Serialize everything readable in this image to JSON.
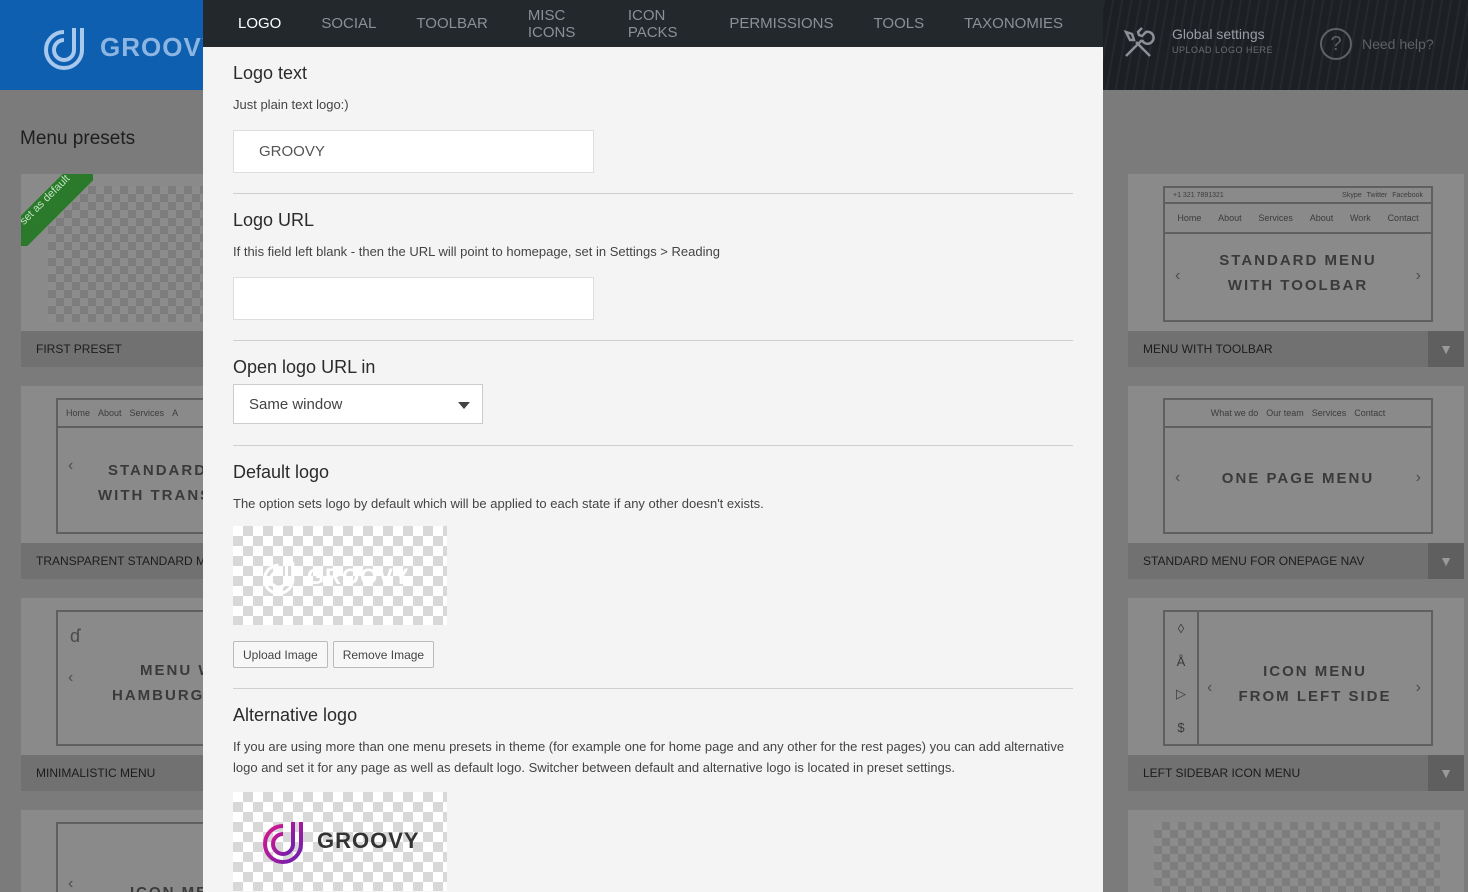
{
  "background": {
    "brand": "GROOVY",
    "global_settings": {
      "title": "Global settings",
      "subtitle": "UPLOAD LOGO HERE"
    },
    "help_label": "Need help?",
    "menu_presets_title": "Menu presets",
    "default_ribbon": "set as default",
    "cards": [
      {
        "label": "FIRST PRESET"
      },
      {
        "label": "TRANSPARENT STANDARD M",
        "preview_title": [
          "STANDARD",
          "WITH TRANS"
        ],
        "nav_items": [
          "Home",
          "About",
          "Services",
          "A"
        ]
      },
      {
        "label": "MINIMALISTIC MENU",
        "preview_title": [
          "MENU W",
          "HAMBURGE"
        ]
      },
      {
        "label": "",
        "preview_title": [
          "ICON ME"
        ]
      },
      {
        "label": "MENU WITH TOOLBAR",
        "preview_title": [
          "STANDARD MENU",
          "WITH TOOLBAR"
        ],
        "toolbar_left": "+1 321 7891321",
        "toolbar_right": [
          "Skype",
          "Twitter",
          "Facebook"
        ],
        "nav_items": [
          "Home",
          "About",
          "Services",
          "About",
          "Work",
          "Contact"
        ]
      },
      {
        "label": "STANDARD MENU FOR ONEPAGE NAV",
        "preview_title": [
          "ONE PAGE MENU"
        ],
        "nav_items": [
          "What we do",
          "Our team",
          "Services",
          "Contact"
        ]
      },
      {
        "label": "LEFT SIDEBAR ICON MENU",
        "preview_title": [
          "ICON MENU",
          "FROM LEFT SIDE"
        ]
      }
    ]
  },
  "modal": {
    "tabs": [
      {
        "label": "LOGO",
        "active": true
      },
      {
        "label": "SOCIAL",
        "active": false
      },
      {
        "label": "TOOLBAR",
        "active": false
      },
      {
        "label": "MISC ICONS",
        "active": false
      },
      {
        "label": "ICON PACKS",
        "active": false
      },
      {
        "label": "PERMISSIONS",
        "active": false
      },
      {
        "label": "TOOLS",
        "active": false
      },
      {
        "label": "TAXONOMIES",
        "active": false
      }
    ],
    "logo_text": {
      "title": "Logo text",
      "description": "Just plain text logo:)",
      "value": "GROOVY"
    },
    "logo_url": {
      "title": "Logo URL",
      "description": "If this field left blank - then the URL will point to homepage, set in Settings > Reading",
      "value": ""
    },
    "open_logo_url": {
      "title": "Open logo URL in",
      "selected": "Same window"
    },
    "default_logo": {
      "title": "Default logo",
      "description": "The option sets logo by default which will be applied to each state if any other doesn't exists.",
      "image_text": "GROOVY",
      "upload_label": "Upload Image",
      "remove_label": "Remove Image"
    },
    "alternative_logo": {
      "title": "Alternative logo",
      "description": "If you are using more than one menu presets in theme (for example one for home page and any other for the rest pages) you can add alternative logo and set it for any page as well as default logo. Switcher between default and alternative logo is located in preset settings.",
      "image_text": "GROOVY"
    }
  }
}
